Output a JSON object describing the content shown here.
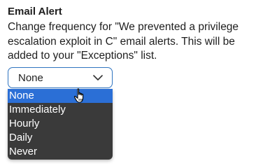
{
  "email_alert": {
    "title": "Email Alert",
    "description": "Change frequency for \"We prevented a privilege escalation exploit in C\" email alerts. This will be added to your \"Exceptions\" list."
  },
  "frequency_select": {
    "selected": "None",
    "options": [
      "None",
      "Immediately",
      "Hourly",
      "Daily",
      "Never"
    ],
    "highlighted_index": 0
  },
  "colors": {
    "accent_border": "#2f74c0",
    "dropdown_bg": "#3a3a3a",
    "highlight": "#2b6fd6"
  },
  "icons": {
    "chevron": "chevron-down-icon",
    "cursor": "hand-pointer-cursor-icon"
  }
}
